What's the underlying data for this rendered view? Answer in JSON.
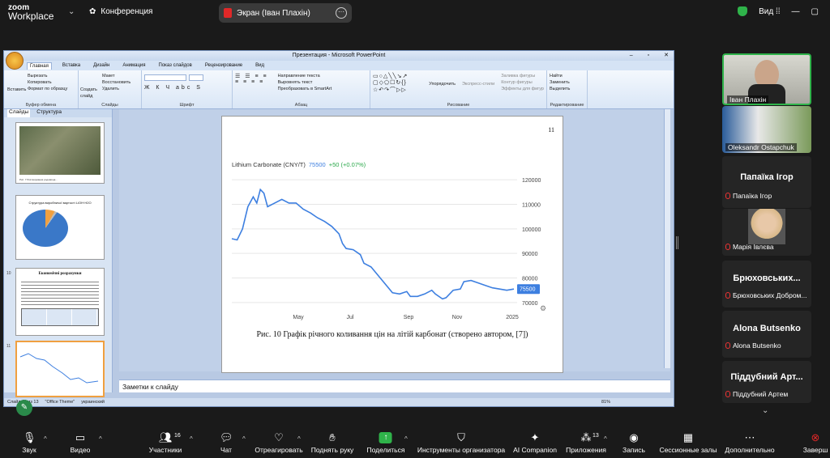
{
  "zoom": {
    "logo_top": "zoom",
    "logo_bottom": "Workplace",
    "conference_label": "Конференция",
    "screen_share_label": "Экран (Іван Плахін)",
    "view_label": "Вид"
  },
  "ppt": {
    "window_title": "Презентация - Microsoft PowerPoint",
    "tabs": [
      "Главная",
      "Вставка",
      "Дизайн",
      "Анимация",
      "Показ слайдов",
      "Рецензирование",
      "Вид"
    ],
    "ribbon": {
      "clipboard": {
        "label": "Буфер обмена",
        "paste": "Вставить",
        "cut": "Вырезать",
        "copy": "Копировать",
        "format_painter": "Формат по образцу"
      },
      "slides": {
        "label": "Слайды",
        "new_slide": "Создать слайд",
        "layout": "Макет",
        "reset": "Восстановить",
        "delete": "Удалить"
      },
      "font": {
        "label": "Шрифт"
      },
      "paragraph": {
        "label": "Абзац",
        "text_direction": "Направление текста",
        "align_text": "Выровнять текст",
        "smartart": "Преобразовать в SmartArt"
      },
      "drawing": {
        "label": "Рисование",
        "arrange": "Упорядочить",
        "quick_styles": "Экспресс-стили",
        "shape_fill": "Заливка фигуры",
        "shape_outline": "Контур фигуры",
        "shape_effects": "Эффекты для фигур"
      },
      "editing": {
        "label": "Редактирование",
        "find": "Найти",
        "replace": "Заменить",
        "select": "Выделить"
      }
    },
    "panel_tabs": [
      "Слайды",
      "Структура"
    ],
    "thumbs": [
      {
        "num": "",
        "caption": "Рис. 7 Розташування родовища..."
      },
      {
        "num": "",
        "title": "Структура виробничої вартості LiOH·H2O"
      },
      {
        "num": "10",
        "title": "Економічні розрахунки"
      },
      {
        "num": "11",
        "caption": ""
      }
    ],
    "notes_label": "Заметки к слайду",
    "status": {
      "slide": "Слайд 11 из 13",
      "theme": "\"Office Theme\"",
      "lang": "украинский",
      "zoom": "81%"
    },
    "slide": {
      "page_number": "11",
      "caption": "Рис. 10 Графік річного коливання цін на літій карбонат (створено автором, [7])"
    }
  },
  "chart_data": {
    "type": "line",
    "title": "Lithium Carbonate (CNY/T)",
    "price_label": "75500",
    "change_label": "+50 (+0.07%)",
    "current_badge": "75500",
    "x_ticks": [
      "May",
      "Jul",
      "Sep",
      "Nov",
      "2025"
    ],
    "y_ticks": [
      "120000",
      "110000",
      "100000",
      "90000",
      "80000",
      "70000"
    ],
    "ylim": [
      68000,
      122000
    ],
    "points": [
      [
        0,
        96000
      ],
      [
        3,
        95500
      ],
      [
        6,
        100000
      ],
      [
        9,
        109000
      ],
      [
        12,
        113000
      ],
      [
        14,
        110500
      ],
      [
        16,
        116000
      ],
      [
        18,
        114500
      ],
      [
        20,
        109000
      ],
      [
        24,
        110500
      ],
      [
        28,
        112000
      ],
      [
        32,
        110500
      ],
      [
        36,
        110500
      ],
      [
        40,
        108000
      ],
      [
        44,
        106500
      ],
      [
        48,
        104500
      ],
      [
        52,
        103000
      ],
      [
        56,
        101000
      ],
      [
        60,
        98000
      ],
      [
        62,
        94000
      ],
      [
        64,
        92000
      ],
      [
        68,
        91500
      ],
      [
        72,
        89500
      ],
      [
        74,
        86000
      ],
      [
        78,
        84500
      ],
      [
        82,
        81000
      ],
      [
        86,
        77500
      ],
      [
        90,
        74000
      ],
      [
        94,
        73500
      ],
      [
        98,
        74500
      ],
      [
        100,
        72500
      ],
      [
        104,
        72500
      ],
      [
        108,
        73500
      ],
      [
        112,
        75000
      ],
      [
        114,
        73500
      ],
      [
        118,
        71500
      ],
      [
        120,
        72000
      ],
      [
        124,
        75000
      ],
      [
        128,
        75500
      ],
      [
        130,
        78500
      ],
      [
        134,
        79000
      ],
      [
        138,
        78000
      ],
      [
        142,
        77000
      ],
      [
        146,
        76000
      ],
      [
        150,
        75500
      ],
      [
        154,
        75000
      ],
      [
        158,
        75500
      ]
    ],
    "xmax": 158
  },
  "participants": [
    {
      "name": "Іван Плахін",
      "video": true
    },
    {
      "name": "Oleksandr Ostapchuk",
      "video": true
    },
    {
      "title": "Папаїка Ігор",
      "sub": "Папаїка Ігор"
    },
    {
      "sub": "Марія Івлєва",
      "avatar": true
    },
    {
      "title": "Брюховських...",
      "sub": "Брюховських Добром..."
    },
    {
      "title": "Alona Butsenko",
      "sub": "Alona Butsenko"
    },
    {
      "title": "Піддубний Арт...",
      "sub": "Піддубний Артем"
    }
  ],
  "toolbar": {
    "audio": "Звук",
    "video": "Видео",
    "participants": "Участники",
    "participants_count": "16",
    "chat": "Чат",
    "react": "Отреагировать",
    "raise_hand": "Поднять руку",
    "share": "Поделиться",
    "host_tools": "Инструменты организатора",
    "ai": "AI Companion",
    "apps": "Приложения",
    "apps_count": "13",
    "record": "Запись",
    "breakout": "Сессионные залы",
    "more": "Дополнительно",
    "end": "Заверш"
  },
  "colors": {
    "accent_green": "#2fb34a",
    "end_red": "#e02828",
    "chart_line": "#3d7fe0",
    "change_green": "#2aa84a"
  }
}
